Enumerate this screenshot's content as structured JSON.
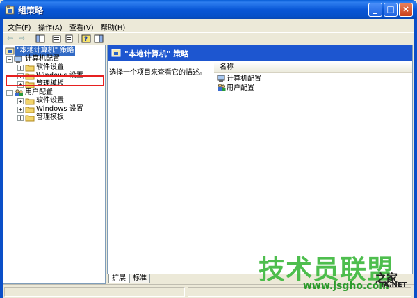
{
  "window": {
    "title": "组策略",
    "min_glyph": "_",
    "max_glyph": "□",
    "close_glyph": "×"
  },
  "menu": {
    "items": [
      "文件(F)",
      "操作(A)",
      "查看(V)",
      "帮助(H)"
    ]
  },
  "toolbar": {
    "back_glyph": "⇦",
    "forward_glyph": "⇨"
  },
  "tree": {
    "root_label": "\"本地计算机\" 策略",
    "computer_config": "计算机配置",
    "software_settings": "软件设置",
    "windows_settings": "Windows 设置",
    "admin_templates": "管理模板",
    "user_config": "用户配置",
    "user_software_settings": "软件设置",
    "user_windows_settings": "Windows 设置",
    "user_admin_templates": "管理模板",
    "expand_glyph": "+",
    "collapse_glyph": "−"
  },
  "right_pane": {
    "header_title": "\"本地计算机\" 策略",
    "description": "选择一个项目来查看它的描述。",
    "column_name": "名称",
    "rows": [
      "计算机配置",
      "用户配置"
    ]
  },
  "tabs": {
    "extended": "扩展",
    "standard": "标准"
  },
  "watermark": {
    "brand": "技术员联盟",
    "site": "www.jsgho.com",
    "suffix_cn": "之家",
    "suffix_en": "IA.NET"
  },
  "colors": {
    "titlebar": "#0856d6",
    "header_bar": "#1d56d0",
    "selection": "#316ac5",
    "highlight_box": "#e62020",
    "watermark_green": "#3bb83b"
  }
}
